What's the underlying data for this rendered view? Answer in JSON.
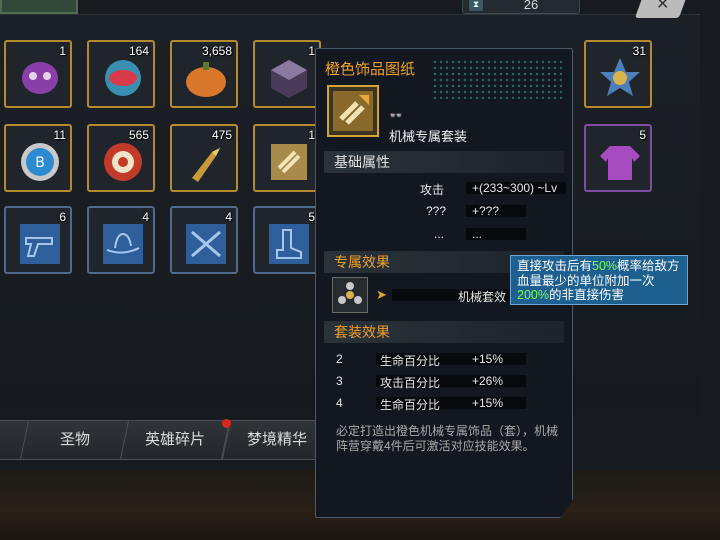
{
  "top_counter": {
    "value": "26",
    "icon": "hourglass-icon"
  },
  "inventory": {
    "slots": [
      {
        "count": "1",
        "icon": "purple-mask-icon",
        "rarity": "gold"
      },
      {
        "count": "164",
        "icon": "red-orb-icon",
        "rarity": "gold"
      },
      {
        "count": "3,658",
        "icon": "pumpkin-icon",
        "rarity": "gold"
      },
      {
        "count": "1",
        "icon": "dark-cube-icon",
        "rarity": "gold"
      },
      {
        "count": "31",
        "icon": "police-badge-icon",
        "rarity": "gold"
      },
      {
        "count": "11",
        "icon": "bottle-cap-icon",
        "rarity": "gold"
      },
      {
        "count": "565",
        "icon": "poker-chip-icon",
        "rarity": "gold"
      },
      {
        "count": "475",
        "icon": "bullet-icon",
        "rarity": "gold"
      },
      {
        "count": "1",
        "icon": "blueprint-icon",
        "rarity": "gold"
      },
      {
        "count": "5",
        "icon": "purple-shirt-icon",
        "rarity": "purple"
      },
      {
        "count": "6",
        "icon": "pistol-blueprint-icon",
        "rarity": "blue"
      },
      {
        "count": "4",
        "icon": "hat-blueprint-icon",
        "rarity": "blue"
      },
      {
        "count": "4",
        "icon": "crossed-rifles-blueprint-icon",
        "rarity": "blue"
      },
      {
        "count": "5",
        "icon": "boot-blueprint-icon",
        "rarity": "blue"
      }
    ]
  },
  "tabs": [
    {
      "label": ""
    },
    {
      "label": "圣物"
    },
    {
      "label": "英雄碎片"
    },
    {
      "label": "梦境精华"
    }
  ],
  "tooltip": {
    "title": "橙色饰品图纸",
    "icon": "gold-blueprint-icon",
    "tag_icon": "goggles-icon",
    "set_name": "机械专属套装",
    "basic_header": "基础属性",
    "basic": [
      {
        "name": "攻击",
        "value": "+(233~300) ~Lv"
      },
      {
        "name": "???",
        "value": "+???"
      },
      {
        "name": "...",
        "value": "..."
      }
    ],
    "exclusive_header": "专属效果",
    "exclusive_icon": "spinner-icon",
    "exclusive_text": "机械套效",
    "set_header": "套装效果",
    "set_bonuses": [
      {
        "pieces": "2",
        "name": "生命百分比",
        "value": "+15%"
      },
      {
        "pieces": "3",
        "name": "攻击百分比",
        "value": "+26%"
      },
      {
        "pieces": "4",
        "name": "生命百分比",
        "value": "+15%"
      }
    ],
    "description": "必定打造出橙色机械专属饰品（套），机械阵营穿戴4件后可激活对应技能效果。"
  },
  "popup": {
    "t1": "直接攻击后有",
    "p1": "50%",
    "t2": "概率给敌方血量最少的单位附加一次",
    "p2": "200%",
    "t3": "的非直接伤害"
  },
  "colors": {
    "accent_gold": "#f1a126",
    "popup_blue": "#1d5f8f",
    "highlight_green": "#7cff4c"
  }
}
